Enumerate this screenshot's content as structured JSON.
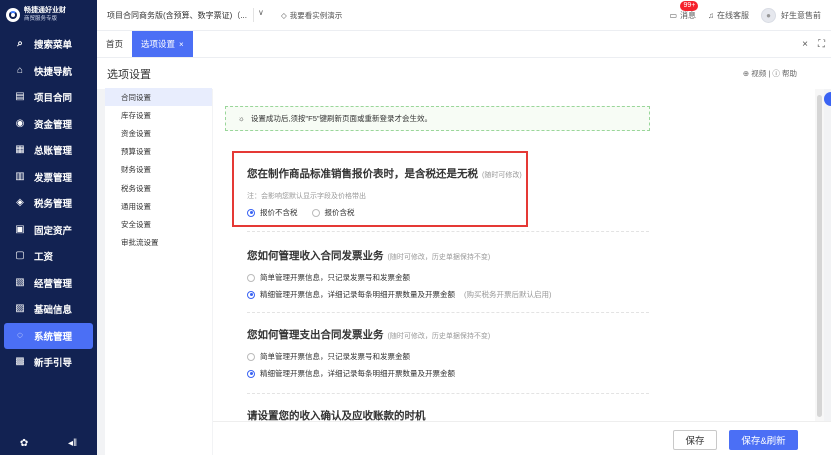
{
  "brand": {
    "name": "畅捷通好业财",
    "edition": "商贸服务专版"
  },
  "sidebar": {
    "items": [
      {
        "label": "搜索菜单",
        "icon": "search-icon",
        "glyph": "⌕",
        "active": false
      },
      {
        "label": "快捷导航",
        "icon": "home-icon",
        "glyph": "⌂",
        "active": false
      },
      {
        "label": "项目合同",
        "icon": "contract-icon",
        "glyph": "▤",
        "active": false
      },
      {
        "label": "资金管理",
        "icon": "fund-icon",
        "glyph": "◉",
        "active": false
      },
      {
        "label": "总账管理",
        "icon": "ledger-icon",
        "glyph": "▦",
        "active": false
      },
      {
        "label": "发票管理",
        "icon": "invoice-icon",
        "glyph": "▥",
        "active": false
      },
      {
        "label": "税务管理",
        "icon": "tax-icon",
        "glyph": "◈",
        "active": false
      },
      {
        "label": "固定资产",
        "icon": "asset-icon",
        "glyph": "▣",
        "active": false
      },
      {
        "label": "工资",
        "icon": "salary-icon",
        "glyph": "▢",
        "active": false
      },
      {
        "label": "经营管理",
        "icon": "operation-icon",
        "glyph": "▧",
        "active": false
      },
      {
        "label": "基础信息",
        "icon": "basic-info-icon",
        "glyph": "▨",
        "active": false
      },
      {
        "label": "系统管理",
        "icon": "system-icon",
        "glyph": "◌",
        "active": true
      },
      {
        "label": "新手引导",
        "icon": "guide-icon",
        "glyph": "▩",
        "active": false
      }
    ],
    "bottom_icons": [
      "settings-icon",
      "collapse-icon"
    ]
  },
  "topbar": {
    "account": "项目合同商务版(含预算、数字票证)（...",
    "demo_link": "我要看实例演示",
    "messages_label": "消息",
    "messages_badge": "99+",
    "service_label": "在线客服",
    "user_name": "好生意售前"
  },
  "tabs": [
    {
      "label": "首页",
      "active": false
    },
    {
      "label": "选项设置",
      "active": true
    }
  ],
  "page": {
    "title": "选项设置",
    "help": "⊕ 视频 | ⓘ 帮助"
  },
  "leftnav": {
    "items": [
      {
        "label": "合同设置",
        "active": true
      },
      {
        "label": "库存设置",
        "active": false
      },
      {
        "label": "资金设置",
        "active": false
      },
      {
        "label": "预算设置",
        "active": false
      },
      {
        "label": "财务设置",
        "active": false
      },
      {
        "label": "税务设置",
        "active": false
      },
      {
        "label": "通用设置",
        "active": false
      },
      {
        "label": "安全设置",
        "active": false
      },
      {
        "label": "审批流设置",
        "active": false
      }
    ]
  },
  "notice": "设置成功后,须按\"F5\"键刷新页面或重新登录才会生效。",
  "sections": [
    {
      "question": "您在制作商品标准销售报价表时，是含税还是无税",
      "tag": "(随时可修改)",
      "note": "注：会影响您默认显示字段及价格带出",
      "options": [
        {
          "label": "报价不含税",
          "checked": true,
          "hint": ""
        },
        {
          "label": "报价含税",
          "checked": false,
          "hint": ""
        }
      ]
    },
    {
      "question": "您如何管理收入合同发票业务",
      "tag": "(随时可修改，历史单据保持不变)",
      "options": [
        {
          "label": "简单管理开票信息，只记录发票号和发票金额",
          "checked": false,
          "hint": ""
        },
        {
          "label": "精细管理开票信息，详细记录每条明细开票数量及开票金额",
          "checked": true,
          "hint": "(购买税务开票后默认启用)"
        }
      ]
    },
    {
      "question": "您如何管理支出合同发票业务",
      "tag": "(随时可修改，历史单据保持不变)",
      "options": [
        {
          "label": "简单管理开票信息，只记录发票号和发票金额",
          "checked": false,
          "hint": ""
        },
        {
          "label": "精细管理开票信息，详细记录每条明细开票数量及开票金额",
          "checked": true,
          "hint": ""
        }
      ]
    },
    {
      "question": "请设置您的收入确认及应收账款的时机",
      "tag": ""
    }
  ],
  "buttons": {
    "save": "保存",
    "save_refresh": "保存&刷新"
  },
  "colors": {
    "sidebar_bg": "#122252",
    "accent": "#4b6ff5",
    "highlight_border": "#e53935"
  }
}
